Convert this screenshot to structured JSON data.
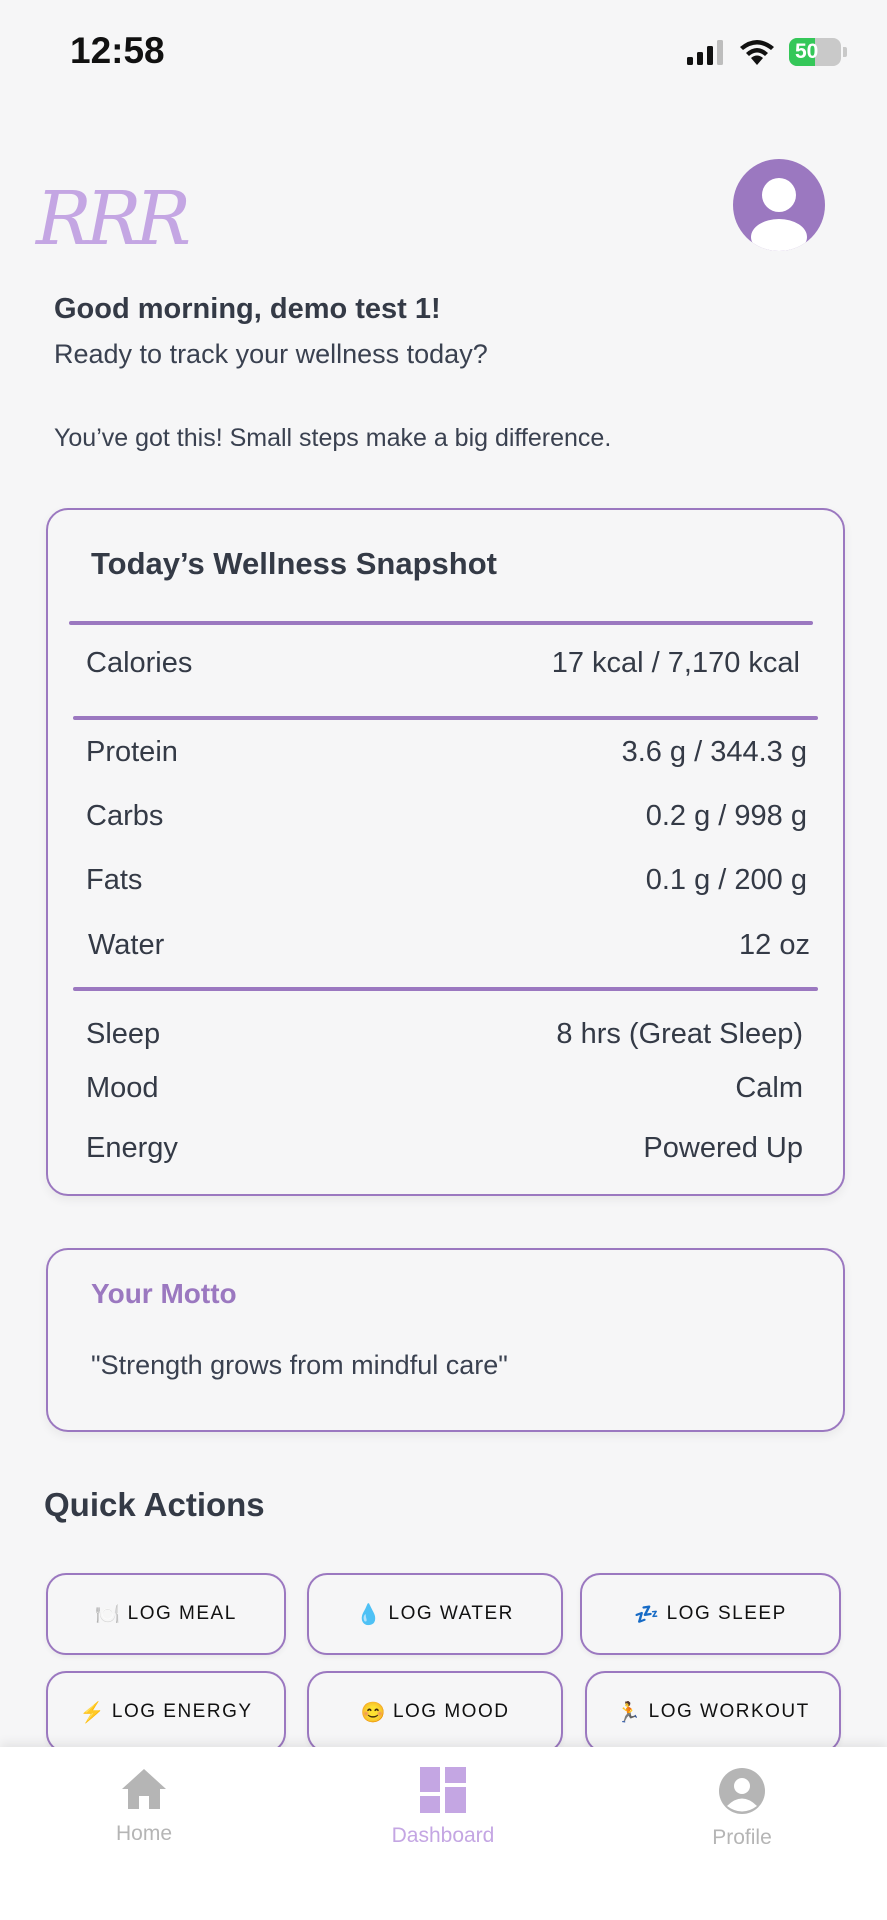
{
  "status_bar": {
    "time": "12:58",
    "battery": "50"
  },
  "header": {
    "logo": "RRR"
  },
  "greeting": {
    "title": "Good morning, demo test 1!",
    "subtitle": "Ready to track your wellness today?",
    "encouragement": "You’ve got this! Small steps make a big difference."
  },
  "snapshot": {
    "title": "Today’s Wellness Snapshot",
    "calories": {
      "label": "Calories",
      "value": "17 kcal / 7,170 kcal"
    },
    "protein": {
      "label": "Protein",
      "value": "3.6 g / 344.3 g"
    },
    "carbs": {
      "label": "Carbs",
      "value": "0.2 g / 998 g"
    },
    "fats": {
      "label": "Fats",
      "value": "0.1 g / 200 g"
    },
    "water": {
      "label": "Water",
      "value": "12 oz"
    },
    "sleep": {
      "label": "Sleep",
      "value": "8 hrs (Great Sleep)"
    },
    "mood": {
      "label": "Mood",
      "value": "Calm"
    },
    "energy": {
      "label": "Energy",
      "value": "Powered Up"
    }
  },
  "motto": {
    "title": "Your Motto",
    "text": "\"Strength grows from mindful care\""
  },
  "quick_actions": {
    "title": "Quick Actions",
    "log_meal": {
      "icon": "🍽️",
      "label": "LOG MEAL"
    },
    "log_water": {
      "icon": "💧",
      "label": "LOG WATER"
    },
    "log_sleep": {
      "icon": "💤",
      "label": "LOG SLEEP"
    },
    "log_energy": {
      "icon": "⚡",
      "label": "LOG ENERGY"
    },
    "log_mood": {
      "icon": "😊",
      "label": "LOG MOOD"
    },
    "log_workout": {
      "icon": "🏃",
      "label": "LOG WORKOUT"
    }
  },
  "nav": {
    "home": "Home",
    "dashboard": "Dashboard",
    "profile": "Profile",
    "active": "Dashboard"
  },
  "colors": {
    "accent": "#9b78c0",
    "accent_light": "#c4a6e3",
    "inactive": "#b5b5b5"
  }
}
